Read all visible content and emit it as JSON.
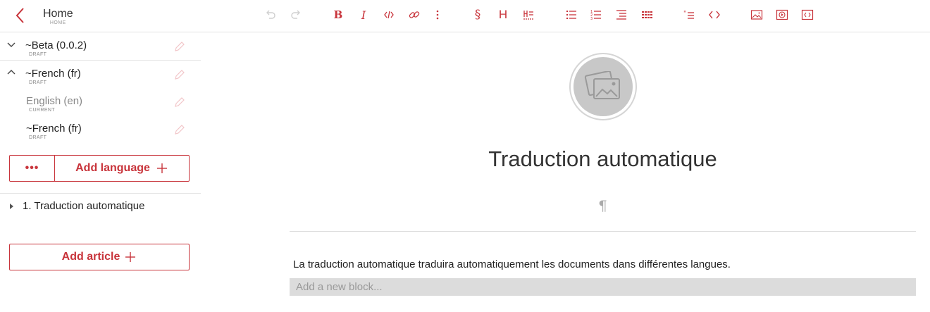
{
  "header": {
    "title": "Home",
    "subtitle": "HOME",
    "accent_color": "#c8343b"
  },
  "toolbar": {
    "tools": [
      {
        "name": "undo",
        "icon": "undo-icon",
        "enabled": false
      },
      {
        "name": "redo",
        "icon": "redo-icon",
        "enabled": false
      },
      {
        "name": "bold",
        "icon": "bold-icon",
        "glyph": "B"
      },
      {
        "name": "italic",
        "icon": "italic-icon",
        "glyph": "I"
      },
      {
        "name": "code-inline",
        "icon": "code-inline-icon"
      },
      {
        "name": "link",
        "icon": "link-icon"
      },
      {
        "name": "more",
        "icon": "kebab-icon"
      },
      {
        "name": "section",
        "icon": "section-icon",
        "glyph": "§"
      },
      {
        "name": "heading",
        "icon": "heading-icon",
        "glyph": "H"
      },
      {
        "name": "heading-numbered",
        "icon": "heading-numbered-icon"
      },
      {
        "name": "bullet-list",
        "icon": "bullet-list-icon"
      },
      {
        "name": "ordered-list",
        "icon": "ordered-list-icon"
      },
      {
        "name": "indent-list",
        "icon": "indent-list-icon"
      },
      {
        "name": "table",
        "icon": "table-icon"
      },
      {
        "name": "quote",
        "icon": "quote-icon"
      },
      {
        "name": "code-block",
        "icon": "code-block-icon"
      },
      {
        "name": "image",
        "icon": "image-icon"
      },
      {
        "name": "video",
        "icon": "video-icon"
      },
      {
        "name": "embed",
        "icon": "embed-icon"
      }
    ]
  },
  "sidebar": {
    "versions": [
      {
        "title": "~Beta (0.0.2)",
        "status": "DRAFT",
        "expanded": false
      },
      {
        "title": "~French (fr)",
        "status": "DRAFT",
        "expanded": true
      }
    ],
    "languages": [
      {
        "title": "English (en)",
        "status": "CURRENT"
      },
      {
        "title": "~French (fr)",
        "status": "DRAFT"
      }
    ],
    "more_label": "•••",
    "add_language_label": "Add language",
    "articles": [
      {
        "label": "1. Traduction automatique"
      }
    ],
    "add_article_label": "Add article"
  },
  "main": {
    "title": "Traduction automatique",
    "pilcrow": "¶",
    "paragraph": "La traduction automatique traduira automatiquement les documents dans différentes langues.",
    "new_block_placeholder": "Add a new block..."
  }
}
